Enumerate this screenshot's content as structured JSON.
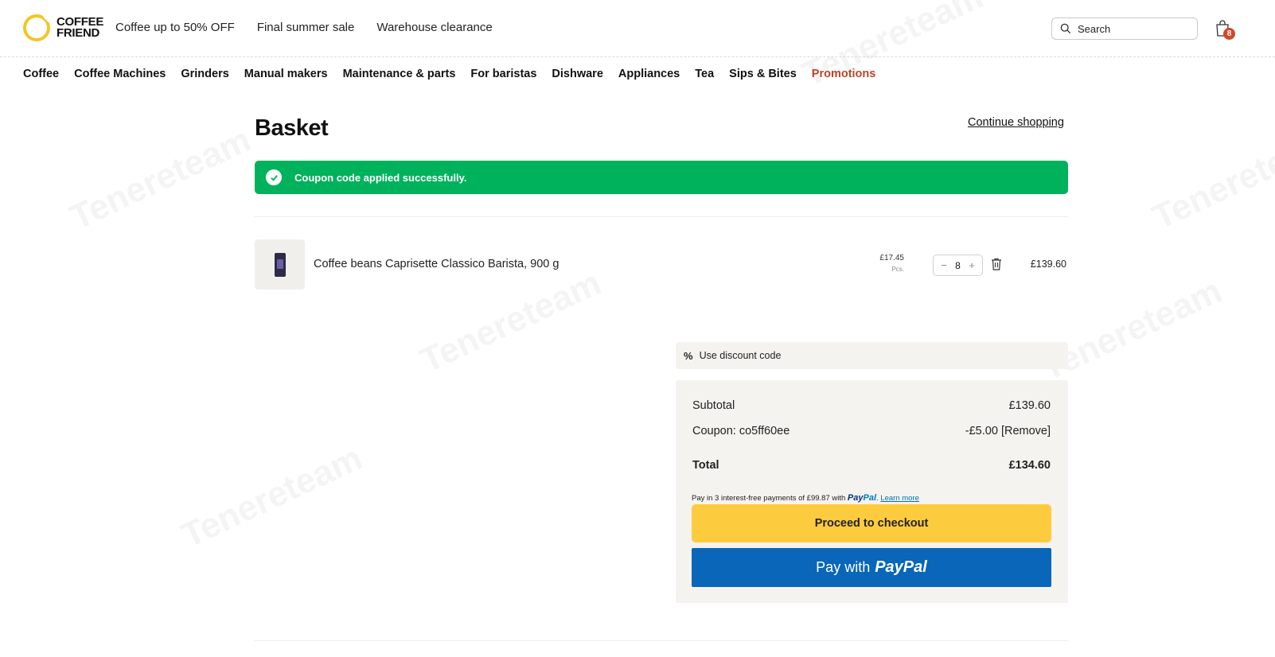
{
  "header": {
    "logo_line1": "COFFEE",
    "logo_line2": "FRIEND",
    "promo_links": [
      "Coffee up to 50% OFF",
      "Final summer sale",
      "Warehouse clearance"
    ],
    "search_placeholder": "Search",
    "cart_count": "8"
  },
  "categories": [
    "Coffee",
    "Coffee Machines",
    "Grinders",
    "Manual makers",
    "Maintenance & parts",
    "For baristas",
    "Dishware",
    "Appliances",
    "Tea",
    "Sips & Bites",
    "Promotions"
  ],
  "basket": {
    "title": "Basket",
    "continue_label": "Continue shopping",
    "alert": "Coupon code applied successfully."
  },
  "item": {
    "name": "Coffee beans Caprisette Classico Barista, 900 g",
    "unit_price": "£17.45",
    "unit_label": "Pcs.",
    "quantity": "8",
    "line_total": "£139.60"
  },
  "summary": {
    "discount_label": "Use discount code",
    "subtotal_label": "Subtotal",
    "subtotal_value": "£139.60",
    "coupon_label": "Coupon: co5ff60ee",
    "coupon_value": "-£5.00",
    "coupon_remove": "[Remove]",
    "total_label": "Total",
    "total_value": "£134.60",
    "paypal_note": "Pay in 3 interest-free payments of £99.87 with",
    "paypal_brand_a": "Pay",
    "paypal_brand_b": "Pal",
    "learn_more": "Learn more",
    "checkout_label": "Proceed to checkout",
    "paypal_button_prefix": "Pay with",
    "paypal_button_brand": "PayPal"
  },
  "watermark": "Tenereteam",
  "colors": {
    "success": "#00b25c",
    "checkout": "#fdcb3e",
    "paypal": "#0a66b8",
    "promotions": "#b8452c",
    "badge": "#d1492d"
  }
}
